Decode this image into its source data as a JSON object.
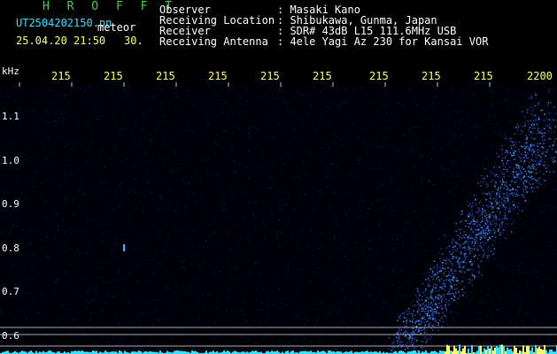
{
  "header": {
    "app_name": "H R O F F T",
    "file_name": "UT2504202150.pn",
    "meteor_label": "meteor",
    "date_time": "25.04.20 21:50",
    "seconds": "30.",
    "info": [
      {
        "label": "Observer",
        "value": ": Masaki Kano"
      },
      {
        "label": "Receiving Location",
        "value": ": Shibukawa, Gunma, Japan"
      },
      {
        "label": "Receiver",
        "value": ": SDR# 43dB L15 111.6MHz USB"
      },
      {
        "label": "Receiving Antenna",
        "value": ": 4ele Yagi Az 230 for Kansai VOR"
      }
    ]
  },
  "plot": {
    "y_unit": "kHz",
    "x_ticks": [
      "215",
      "215",
      "215",
      "215",
      "215",
      "215",
      "215",
      "215",
      "215",
      "2200"
    ],
    "y_ticks": [
      "1.1",
      "1.0",
      "0.9",
      "0.8",
      "0.7",
      "0.6"
    ],
    "colors": {
      "background": "#000008",
      "noise": "#1a2a9a",
      "signal": "#3fb4ff",
      "grid": "#c8c8c8",
      "tick_text": "#ffff66",
      "baseline": "#35e0ff"
    }
  }
}
